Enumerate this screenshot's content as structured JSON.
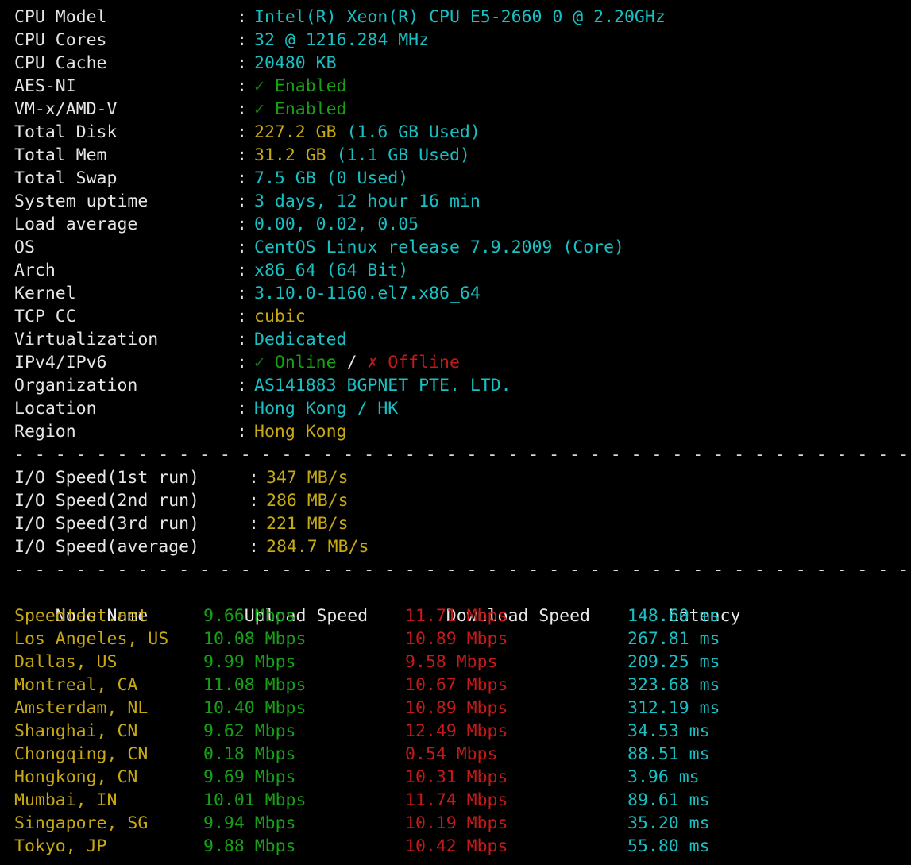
{
  "terminal": {
    "colors": {
      "background": "#000000",
      "label": "#e6e6e6",
      "cyan": "#18c0c4",
      "yellow": "#c7a913",
      "green": "#17a117",
      "dark_green": "#187818",
      "red": "#c41a1a",
      "white": "#e8e8e8"
    },
    "separator": "-------------------------------------------------"
  },
  "system_info": {
    "rows": [
      {
        "label": "CPU Model",
        "colon": ":",
        "value": "Intel(R) Xeon(R) CPU E5-2660 0 @ 2.20GHz"
      },
      {
        "label": "CPU Cores",
        "colon": ":",
        "value": "32 @ 1216.284 MHz"
      },
      {
        "label": "CPU Cache",
        "colon": ":",
        "value": "20480 KB"
      },
      {
        "label": "AES-NI",
        "colon": ":",
        "icon": "✓",
        "value": "Enabled"
      },
      {
        "label": "VM-x/AMD-V",
        "colon": ":",
        "icon": "✓",
        "value": "Enabled"
      },
      {
        "label": "Total Disk",
        "colon": ":",
        "value_main": "227.2 GB",
        "value_sub": "(1.6 GB Used)"
      },
      {
        "label": "Total Mem",
        "colon": ":",
        "value_main": "31.2 GB",
        "value_sub": "(1.1 GB Used)"
      },
      {
        "label": "Total Swap",
        "colon": ":",
        "value": "7.5 GB (0 Used)"
      },
      {
        "label": "System uptime",
        "colon": ":",
        "value": "3 days, 12 hour 16 min"
      },
      {
        "label": "Load average",
        "colon": ":",
        "value": "0.00, 0.02, 0.05"
      },
      {
        "label": "OS",
        "colon": ":",
        "value": "CentOS Linux release 7.9.2009 (Core)"
      },
      {
        "label": "Arch",
        "colon": ":",
        "value": "x86_64 (64 Bit)"
      },
      {
        "label": "Kernel",
        "colon": ":",
        "value": "3.10.0-1160.el7.x86_64"
      },
      {
        "label": "TCP CC",
        "colon": ":",
        "value": "cubic"
      },
      {
        "label": "Virtualization",
        "colon": ":",
        "value": "Dedicated"
      },
      {
        "label": "IPv4/IPv6",
        "colon": ":",
        "ipv4_icon": "✓",
        "ipv4": "Online",
        "divider": "/",
        "ipv6_icon": "✗",
        "ipv6": "Offline"
      },
      {
        "label": "Organization",
        "colon": ":",
        "value": "AS141883 BGPNET PTE. LTD."
      },
      {
        "label": "Location",
        "colon": ":",
        "value": "Hong Kong / HK"
      },
      {
        "label": "Region",
        "colon": ":",
        "value": "Hong Kong"
      }
    ]
  },
  "io_speed": {
    "rows": [
      {
        "label": "I/O Speed(1st run)",
        "colon": ":",
        "value": "347 MB/s"
      },
      {
        "label": "I/O Speed(2nd run)",
        "colon": ":",
        "value": "286 MB/s"
      },
      {
        "label": "I/O Speed(3rd run)",
        "colon": ":",
        "value": "221 MB/s"
      },
      {
        "label": "I/O Speed(average)",
        "colon": ":",
        "value": "284.7 MB/s"
      }
    ]
  },
  "speedtest": {
    "headers": {
      "node": "Node Name",
      "upload": "Upload Speed",
      "download": "Download Speed",
      "latency": "Latency"
    },
    "rows": [
      {
        "node": "Speedtest.net",
        "upload": "9.66 Mbps",
        "download": "11.71 Mbps",
        "latency": "148.60 ms"
      },
      {
        "node": "Los Angeles, US",
        "upload": "10.08 Mbps",
        "download": "10.89 Mbps",
        "latency": "267.81 ms"
      },
      {
        "node": "Dallas, US",
        "upload": "9.99 Mbps",
        "download": "9.58 Mbps",
        "latency": "209.25 ms"
      },
      {
        "node": "Montreal, CA",
        "upload": "11.08 Mbps",
        "download": "10.67 Mbps",
        "latency": "323.68 ms"
      },
      {
        "node": "Amsterdam, NL",
        "upload": "10.40 Mbps",
        "download": "10.89 Mbps",
        "latency": "312.19 ms"
      },
      {
        "node": "Shanghai, CN",
        "upload": "9.62 Mbps",
        "download": "12.49 Mbps",
        "latency": "34.53 ms"
      },
      {
        "node": "Chongqing, CN",
        "upload": "0.18 Mbps",
        "download": "0.54 Mbps",
        "latency": "88.51 ms"
      },
      {
        "node": "Hongkong, CN",
        "upload": "9.69 Mbps",
        "download": "10.31 Mbps",
        "latency": "3.96 ms"
      },
      {
        "node": "Mumbai, IN",
        "upload": "10.01 Mbps",
        "download": "11.74 Mbps",
        "latency": "89.61 ms"
      },
      {
        "node": "Singapore, SG",
        "upload": "9.94 Mbps",
        "download": "10.19 Mbps",
        "latency": "35.20 ms"
      },
      {
        "node": "Tokyo, JP",
        "upload": "9.88 Mbps",
        "download": "10.42 Mbps",
        "latency": "55.80 ms"
      }
    ]
  }
}
